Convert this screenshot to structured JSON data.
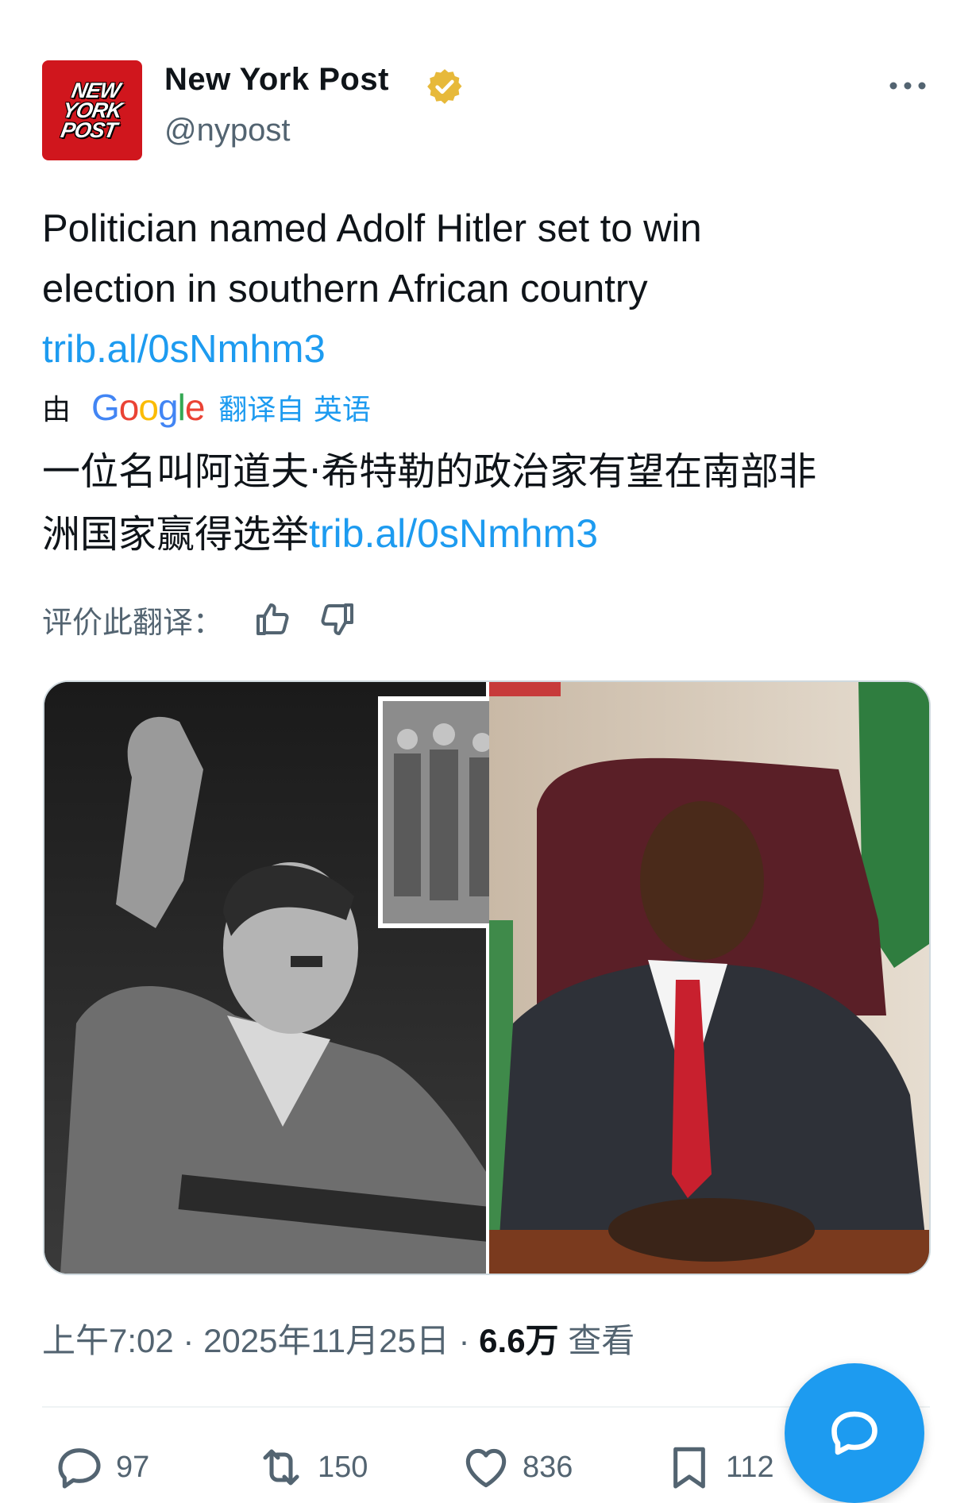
{
  "account": {
    "avatar_text": [
      "NEW",
      "YORK",
      "POST"
    ],
    "name": "New York Post",
    "handle": "@nypost"
  },
  "tweet": {
    "text_line1": "Politician named Adolf Hitler set to win",
    "text_line2": "election in southern African country",
    "link": "trib.al/0sNmhm3"
  },
  "translation": {
    "by_label": "由",
    "provider": "Google",
    "from_label": "翻译自 英语",
    "text_line1": "一位名叫阿道夫·希特勒的政治家有望在南部非",
    "text_line2": "洲国家赢得选举",
    "link": "trib.al/0sNmhm3",
    "rate_label": "评价此翻译："
  },
  "meta": {
    "time": "上午7:02",
    "date": "2025年11月25日",
    "views": "6.6万",
    "views_label": "查看"
  },
  "actions": {
    "replies": "97",
    "reposts": "150",
    "likes": "836",
    "bookmarks": "112"
  },
  "colors": {
    "accent": "#1d9bf0",
    "avatar_red": "#d0161d",
    "verified_gold": "#e7b93a",
    "secondary_text": "#536471"
  }
}
